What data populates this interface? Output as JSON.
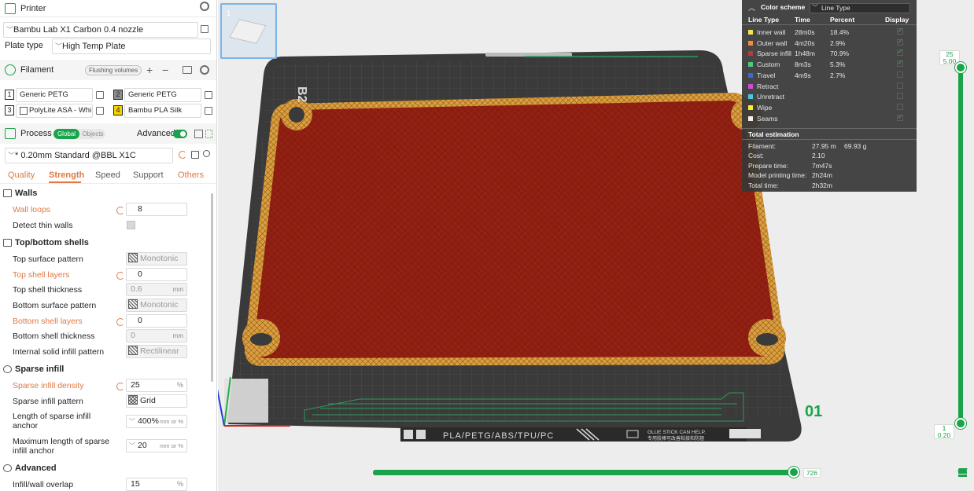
{
  "printer": {
    "title": "Printer",
    "machine": "Bambu Lab X1 Carbon 0.4 nozzle",
    "plate_type_label": "Plate type",
    "plate_type_value": "High Temp Plate"
  },
  "filament": {
    "title": "Filament",
    "flushing_label": "Flushing volumes",
    "add": "+",
    "remove": "−",
    "items": [
      {
        "num": "1",
        "name": "Generic PETG",
        "color": "#ffffff"
      },
      {
        "num": "2",
        "name": "Generic PETG",
        "color": "#8c8c8c"
      },
      {
        "num": "3",
        "name": "PolyLite ASA - Whi...",
        "color": "#ffffff"
      },
      {
        "num": "4",
        "name": "Bambu PLA Silk",
        "color": "#f5d000"
      }
    ]
  },
  "process": {
    "title": "Process",
    "global_label": "Global",
    "objects_label": "Objects",
    "advanced_label": "Advanced",
    "preset": "* 0.20mm Standard @BBL X1C",
    "tabs": [
      "Quality",
      "Strength",
      "Speed",
      "Support",
      "Others"
    ]
  },
  "settings": {
    "walls": {
      "title": "Walls",
      "wall_loops_label": "Wall loops",
      "wall_loops_value": "8",
      "detect_thin_label": "Detect thin walls"
    },
    "topbottom": {
      "title": "Top/bottom shells",
      "top_pattern_label": "Top surface pattern",
      "top_pattern_value": "Monotonic ...",
      "top_layers_label": "Top shell layers",
      "top_layers_value": "0",
      "top_thick_label": "Top shell thickness",
      "top_thick_value": "0.6",
      "bottom_pattern_label": "Bottom surface pattern",
      "bottom_pattern_value": "Monotonic",
      "bottom_layers_label": "Bottom shell layers",
      "bottom_layers_value": "0",
      "bottom_thick_label": "Bottom shell thickness",
      "bottom_thick_value": "0",
      "internal_label": "Internal solid infill pattern",
      "internal_value": "Rectilinear",
      "unit_mm": "mm"
    },
    "sparse": {
      "title": "Sparse infill",
      "density_label": "Sparse infill density",
      "density_value": "25",
      "density_unit": "%",
      "pattern_label": "Sparse infill pattern",
      "pattern_value": "Grid",
      "anchor_label_1": "Length of sparse infill",
      "anchor_label_2": "anchor",
      "anchor_value": "400%",
      "anchor_unit": "mm or %",
      "maxanchor_label_1": "Maximum length of sparse",
      "maxanchor_label_2": "infill anchor",
      "maxanchor_value": "20",
      "maxanchor_unit": "mm or %"
    },
    "advanced": {
      "title": "Advanced",
      "overlap_label": "Infill/wall overlap",
      "overlap_value": "15",
      "overlap_unit": "%"
    }
  },
  "thumbnail": {
    "num": "1"
  },
  "color_scheme": {
    "title": "Color scheme",
    "value": "Line Type",
    "headers": [
      "Line Type",
      "Time",
      "Percent",
      "Display"
    ],
    "rows": [
      {
        "name": "Inner wall",
        "time": "28m0s",
        "percent": "18.4%",
        "color": "#f2e552",
        "display": true
      },
      {
        "name": "Outer wall",
        "time": "4m20s",
        "percent": "2.9%",
        "color": "#f08c3c",
        "display": true
      },
      {
        "name": "Sparse infill",
        "time": "1h48m",
        "percent": "70.9%",
        "color": "#b83a3a",
        "display": true
      },
      {
        "name": "Custom",
        "time": "8m3s",
        "percent": "5.3%",
        "color": "#4fc880",
        "display": true
      },
      {
        "name": "Travel",
        "time": "4m9s",
        "percent": "2.7%",
        "color": "#3a6ad0",
        "display": false
      },
      {
        "name": "Retract",
        "time": "",
        "percent": "",
        "color": "#d04ad8",
        "display": false
      },
      {
        "name": "Unretract",
        "time": "",
        "percent": "",
        "color": "#4ac8d8",
        "display": false
      },
      {
        "name": "Wipe",
        "time": "",
        "percent": "",
        "color": "#f2f230",
        "display": false
      },
      {
        "name": "Seams",
        "time": "",
        "percent": "",
        "color": "#f0f0f0",
        "display": true
      }
    ],
    "total_title": "Total estimation",
    "totals": [
      {
        "label": "Filament:",
        "value": "27.95 m",
        "value2": "69.93 g"
      },
      {
        "label": "Cost:",
        "value": "2.10",
        "value2": ""
      },
      {
        "label": "Prepare time:",
        "value": "7m47s",
        "value2": ""
      },
      {
        "label": "Model printing time:",
        "value": "2h24m",
        "value2": ""
      },
      {
        "label": "Total time:",
        "value": "2h32m",
        "value2": ""
      }
    ]
  },
  "plate": {
    "label": "PLA/PETG/ABS/TPU/PC",
    "glue_1": "GLUE STICK CAN HELP.",
    "glue_2": "专用胶棒可改善粘接和防翘",
    "plate_number": "01"
  },
  "layer_slider": {
    "top_layer": "25",
    "top_height": "5.00",
    "bottom_layer": "1",
    "bottom_height": "0.20"
  },
  "move_slider": {
    "value": "726"
  },
  "colors": {
    "accent": "#1aa34a",
    "modified": "#e07840",
    "infill": "#8a1c10"
  }
}
